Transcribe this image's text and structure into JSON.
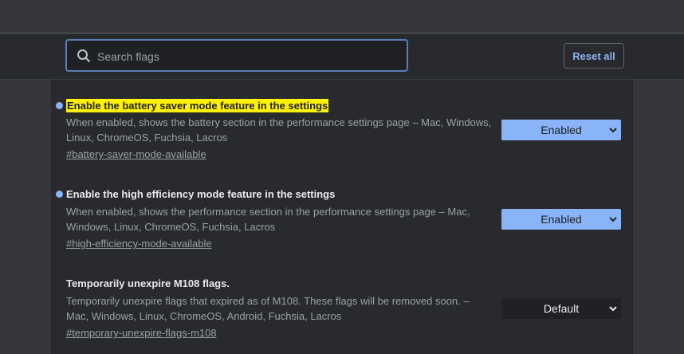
{
  "search": {
    "placeholder": "Search flags",
    "icon": "search-icon"
  },
  "toolbar": {
    "reset_label": "Reset all"
  },
  "colors": {
    "accent": "#8ab4f8",
    "highlight": "#fff200"
  },
  "flags": [
    {
      "title": "Enable the battery saver mode feature in the settings",
      "highlighted": true,
      "description": "When enabled, shows the battery section in the performance settings page – Mac, Windows, Linux, ChromeOS, Fuchsia, Lacros",
      "link": "#battery-saver-mode-available",
      "value": "Enabled",
      "modified": true
    },
    {
      "title": "Enable the high efficiency mode feature in the settings",
      "highlighted": false,
      "description": "When enabled, shows the performance section in the performance settings page – Mac, Windows, Linux, ChromeOS, Fuchsia, Lacros",
      "link": "#high-efficiency-mode-available",
      "value": "Enabled",
      "modified": true
    },
    {
      "title": "Temporarily unexpire M108 flags.",
      "highlighted": false,
      "description": "Temporarily unexpire flags that expired as of M108. These flags will be removed soon. – Mac, Windows, Linux, ChromeOS, Android, Fuchsia, Lacros",
      "link": "#temporary-unexpire-flags-m108",
      "value": "Default",
      "modified": false
    }
  ]
}
